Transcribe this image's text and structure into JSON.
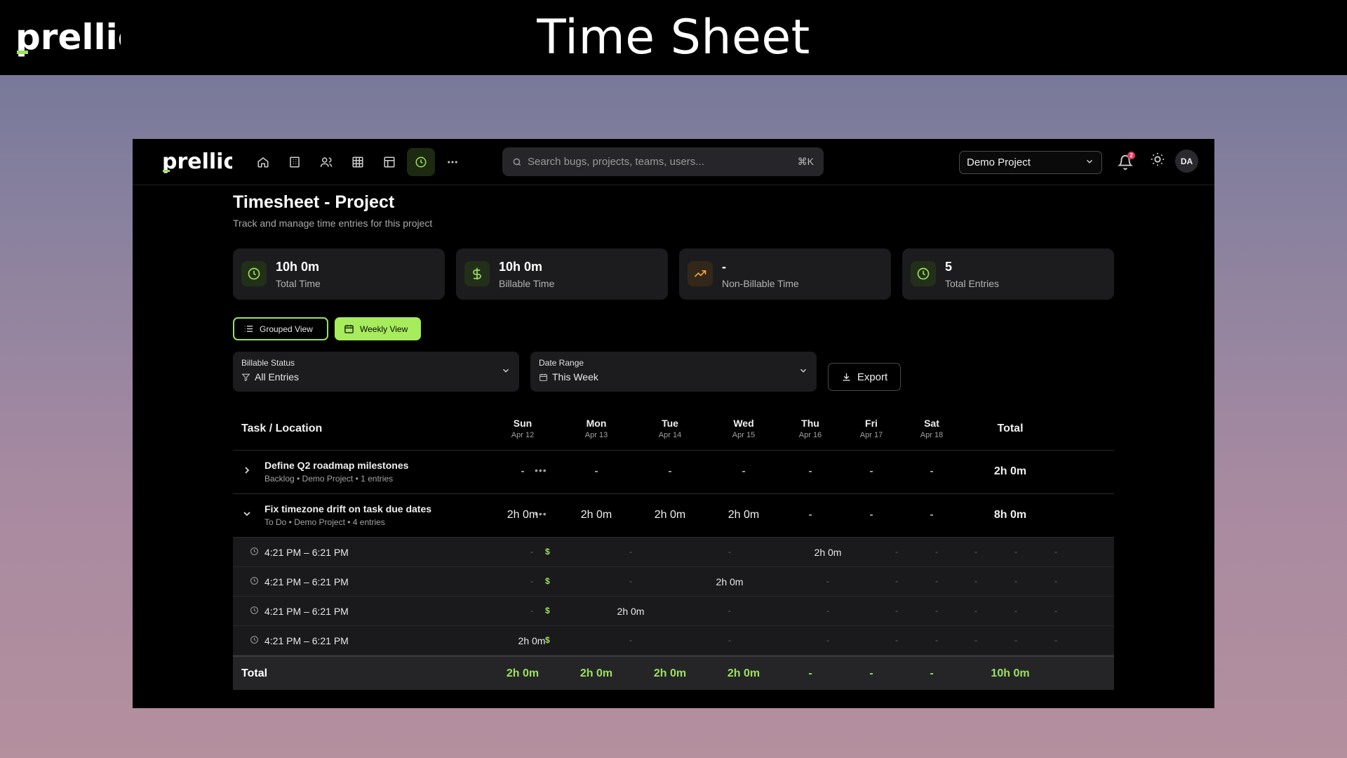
{
  "banner": {
    "logo_text": "prellio",
    "title": "Time Sheet"
  },
  "navbar": {
    "logo_text": "prellio",
    "icons": [
      "home-icon",
      "building-icon",
      "users-icon",
      "grid-icon",
      "layout-icon",
      "clock-icon",
      "more-icon"
    ],
    "search": {
      "placeholder": "Search bugs, projects, teams, users...",
      "shortcut": "⌘K"
    },
    "project": "Demo Project",
    "notifications_count": "2",
    "avatar": "DA"
  },
  "page": {
    "title": "Timesheet - Project",
    "subtitle": "Track and manage time entries for this project"
  },
  "stats": [
    {
      "value": "10h 0m",
      "label": "Total Time",
      "icon": "clock-icon"
    },
    {
      "value": "10h 0m",
      "label": "Billable Time",
      "icon": "dollar-icon"
    },
    {
      "value": "-",
      "label": "Non-Billable Time",
      "icon": "trending-up-icon"
    },
    {
      "value": "5",
      "label": "Total Entries",
      "icon": "clock-icon"
    }
  ],
  "views": {
    "grouped": "Grouped View",
    "weekly": "Weekly View",
    "active": "weekly"
  },
  "filters": {
    "billable": {
      "label": "Billable Status",
      "value": "All Entries"
    },
    "date_range": {
      "label": "Date Range",
      "value": "This Week"
    }
  },
  "export_label": "Export",
  "table": {
    "task_header": "Task / Location",
    "days": [
      {
        "day": "Sun",
        "date": "Apr 12"
      },
      {
        "day": "Mon",
        "date": "Apr 13"
      },
      {
        "day": "Tue",
        "date": "Apr 14"
      },
      {
        "day": "Wed",
        "date": "Apr 15"
      },
      {
        "day": "Thu",
        "date": "Apr 16"
      },
      {
        "day": "Fri",
        "date": "Apr 17"
      },
      {
        "day": "Sat",
        "date": "Apr 18"
      }
    ],
    "total_header": "Total",
    "tasks": [
      {
        "name": "Define Q2 roadmap milestones",
        "meta": "Backlog • Demo Project • 1 entries",
        "cells": [
          "-",
          "-",
          "-",
          "-",
          "-",
          "-",
          "-"
        ],
        "total": "2h 0m"
      },
      {
        "name": "Fix timezone drift on task due dates",
        "meta": "To Do • Demo Project • 4 entries",
        "cells": [
          "2h 0m",
          "2h 0m",
          "2h 0m",
          "2h 0m",
          "-",
          "-",
          "-"
        ],
        "total": "8h 0m"
      }
    ],
    "entries": [
      {
        "time": "4:21 PM – 6:21 PM",
        "billable": "$",
        "cells": [
          "-",
          "-",
          "-",
          "2h 0m",
          "-",
          "-",
          "-",
          "-",
          "-"
        ]
      },
      {
        "time": "4:21 PM – 6:21 PM",
        "billable": "$",
        "cells": [
          "-",
          "-",
          "2h 0m",
          "-",
          "-",
          "-",
          "-",
          "-",
          "-"
        ]
      },
      {
        "time": "4:21 PM – 6:21 PM",
        "billable": "$",
        "cells": [
          "-",
          "2h 0m",
          "-",
          "-",
          "-",
          "-",
          "-",
          "-",
          "-"
        ]
      },
      {
        "time": "4:21 PM – 6:21 PM",
        "billable": "$",
        "cells": [
          "2h 0m",
          "-",
          "-",
          "-",
          "-",
          "-",
          "-",
          "-",
          "-"
        ]
      }
    ],
    "totals": {
      "label": "Total",
      "cells": [
        "2h 0m",
        "2h 0m",
        "2h 0m",
        "2h 0m",
        "-",
        "-",
        "-"
      ],
      "total": "10h 0m"
    }
  },
  "colors": {
    "accent": "#9be15d",
    "accent_button": "#a6ec5c",
    "orange": "#f2a24a"
  }
}
